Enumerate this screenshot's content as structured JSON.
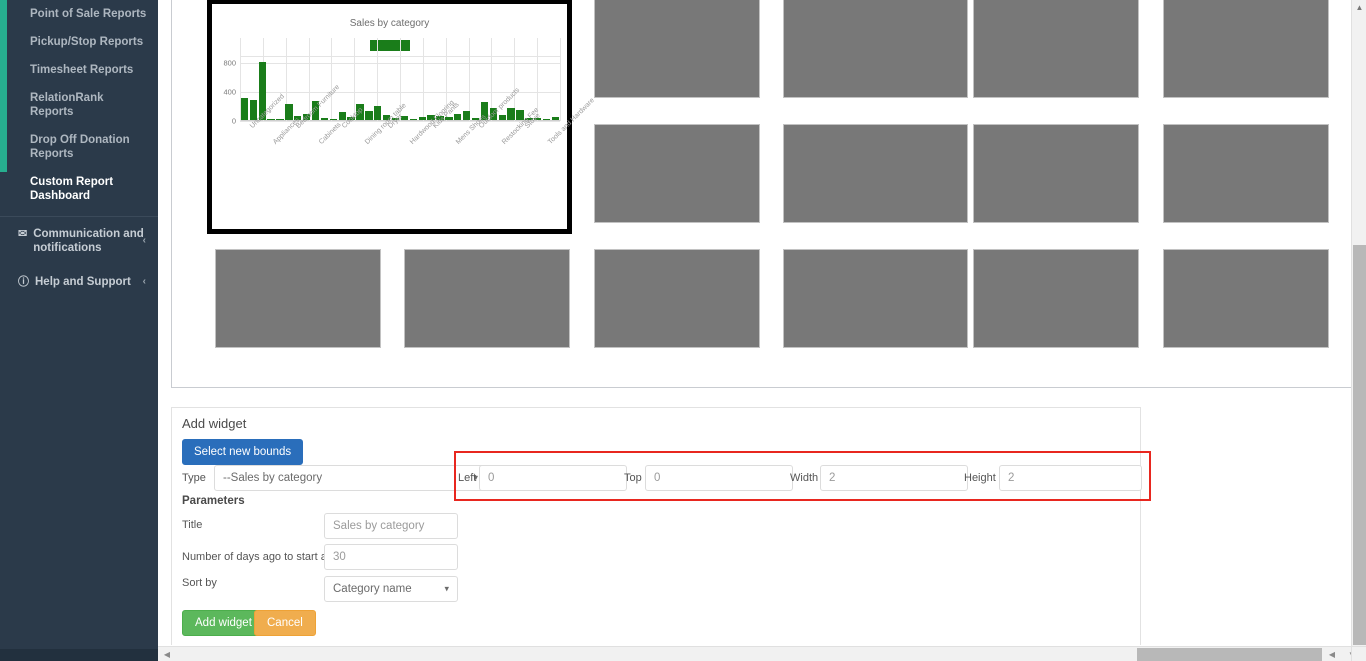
{
  "sidebar": {
    "items": [
      {
        "label": "Point of Sale Reports",
        "active": false
      },
      {
        "label": "Pickup/Stop Reports",
        "active": false
      },
      {
        "label": "Timesheet Reports",
        "active": false
      },
      {
        "label": "RelationRank Reports",
        "active": false
      },
      {
        "label": "Drop Off Donation Reports",
        "active": false
      },
      {
        "label": "Custom Report Dashboard",
        "active": true
      }
    ],
    "sections": [
      {
        "icon": "envelope-icon",
        "glyph": "✉",
        "label": "Communication and notifications",
        "chevron": "‹"
      },
      {
        "icon": "help-circle-icon",
        "glyph": "ⓘ",
        "label": "Help and Support",
        "chevron": "‹"
      }
    ],
    "accent_color": "#27ae8f",
    "background_color": "#2b3a4a"
  },
  "form": {
    "title": "Add widget",
    "select_bounds_label": "Select new bounds",
    "type_label": "Type",
    "type_value": "--Sales by category",
    "bounds": [
      {
        "label": "Left",
        "value": "0"
      },
      {
        "label": "Top",
        "value": "0"
      },
      {
        "label": "Width",
        "value": "2"
      },
      {
        "label": "Height",
        "value": "2"
      }
    ],
    "parameters_label": "Parameters",
    "fields": [
      {
        "label": "Title",
        "value": "Sales by category",
        "kind": "input"
      },
      {
        "label": "Number of days ago to start at",
        "value": "30",
        "kind": "input"
      },
      {
        "label": "Sort by",
        "value": "Category name",
        "kind": "select"
      }
    ],
    "submit_label": "Add widget",
    "cancel_label": "Cancel",
    "highlight_color": "#e8271f",
    "primary_button_color": "#2a6ebb",
    "submit_button_color": "#5cb85c",
    "cancel_button_color": "#f0ad4e"
  },
  "chart_data": {
    "type": "bar",
    "title": "Sales by category",
    "xlabel": "",
    "ylabel": "",
    "ylim": [
      0,
      900
    ],
    "yticks": [
      0,
      400,
      800
    ],
    "grid": true,
    "legend_position": "top-center",
    "legend_swatch_color": "#1a7d1a",
    "bar_color": "#1a7d1a",
    "categories": [
      "Uncategorized",
      "Appliances",
      "Bedroom Furniture",
      "Cabinets",
      "Cooktop",
      "Dining room table",
      "Dryer",
      "Hardwood Flooring",
      "Kids Pants",
      "Mens Shoes",
      "Outdoor products",
      "Restocking Fee",
      "Stove",
      "Tools and Hardware"
    ],
    "values": [
      300,
      275,
      810,
      5,
      12,
      215,
      60,
      80,
      265,
      30,
      5,
      110,
      45,
      215,
      130,
      195,
      65,
      30,
      60,
      10,
      35,
      75,
      55,
      45,
      85,
      125,
      25,
      250,
      165,
      75,
      160,
      140,
      30,
      25,
      5,
      35
    ],
    "tick_count": 14
  },
  "dashboard": {
    "selected_widget_title": "Sales by category",
    "placeholder_count": 14,
    "placeholder_color": "#787878"
  },
  "scrollbars": {
    "vertical_thumb_color": "#b8b8b8",
    "horizontal_thumb_color": "#b8b8b8",
    "left_arrow_glyph": "◀",
    "right_arrow_glyph": "▶",
    "down_arrow_glyph": "▼",
    "up_arrow_glyph": "▲"
  }
}
